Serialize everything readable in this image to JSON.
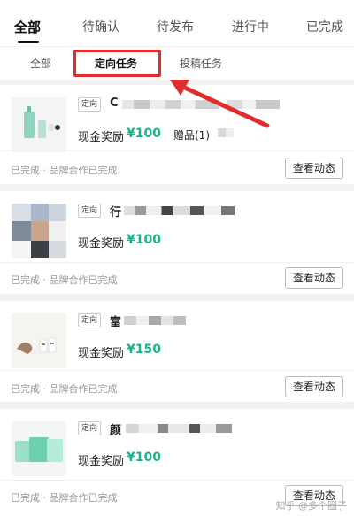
{
  "top_tabs": [
    "全部",
    "待确认",
    "待发布",
    "进行中",
    "已完成"
  ],
  "sub_tabs": [
    "全部",
    "定向任务",
    "投稿任务"
  ],
  "accent_color": "#19b38a",
  "highlight_color": "#e02d2d",
  "tasks": [
    {
      "tag": "定向",
      "title_start": "C",
      "reward_label": "现金奖励",
      "reward": "¥100",
      "gift": "赠品(1)",
      "status": "已完成 · 品牌合作已完成",
      "action": "查看动态"
    },
    {
      "tag": "定向",
      "title_start": "行",
      "reward_label": "现金奖励",
      "reward": "¥100",
      "status": "已完成 · 品牌合作已完成",
      "action": "查看动态"
    },
    {
      "tag": "定向",
      "title_start": "富",
      "reward_label": "现金奖励",
      "reward": "¥150",
      "status": "已完成 · 品牌合作已完成",
      "action": "查看动态"
    },
    {
      "tag": "定向",
      "title_start": "颜",
      "reward_label": "现金奖励",
      "reward": "¥100",
      "status": "已完成 · 品牌合作已完成",
      "action": "查看动态"
    }
  ],
  "watermark": "知乎 @多个圈子"
}
